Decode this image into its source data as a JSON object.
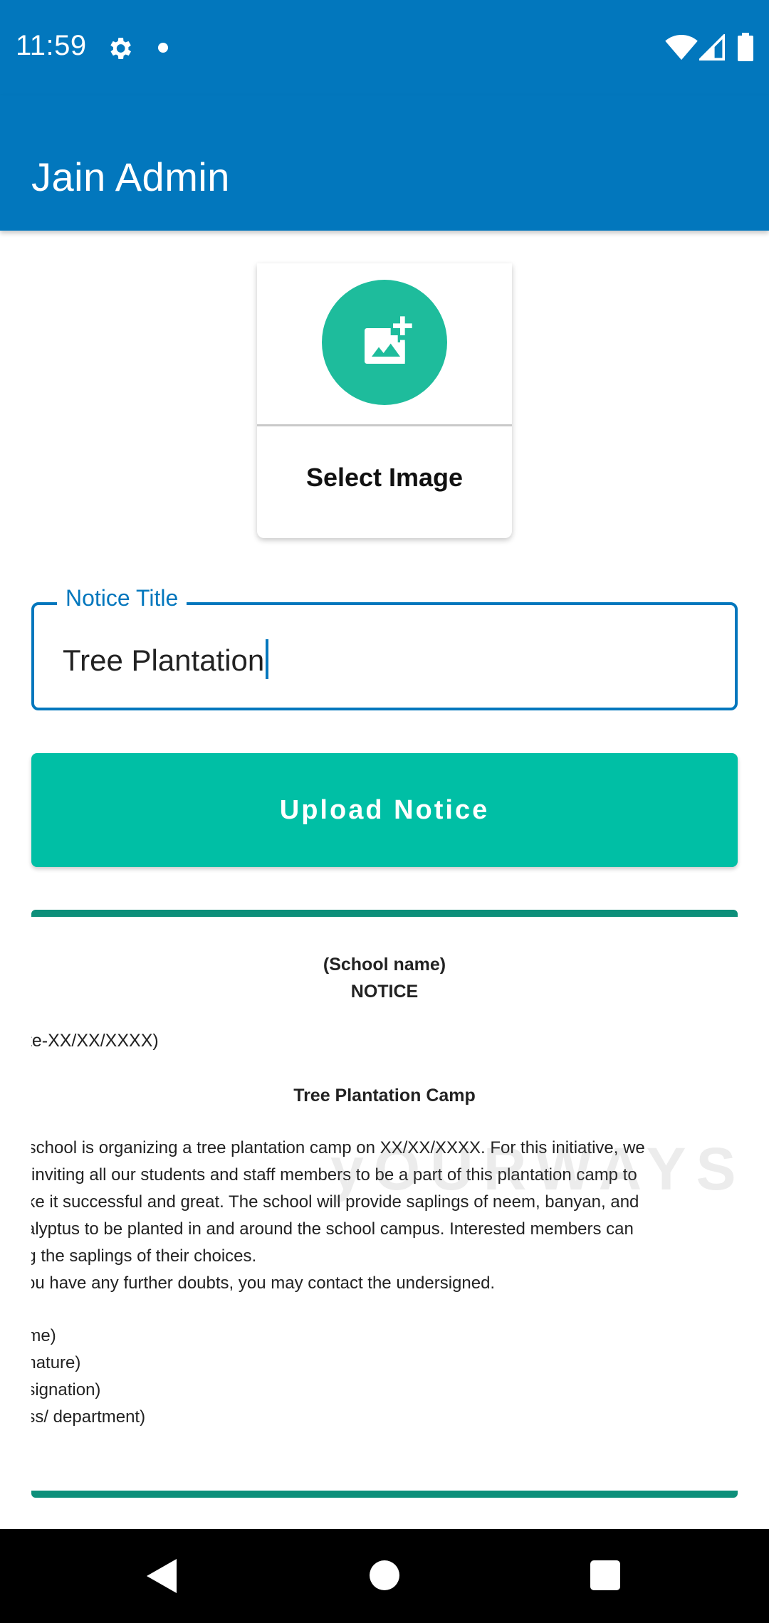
{
  "status_bar": {
    "time": "11:59",
    "icons": [
      "gear-icon",
      "notification-dot-icon",
      "wifi-icon",
      "signal-icon",
      "battery-icon"
    ]
  },
  "app_bar": {
    "title": "Jain Admin",
    "color": "#0277bd"
  },
  "image_picker": {
    "label": "Select Image",
    "icon": "add-photo-icon",
    "accent": "#1ebc9c"
  },
  "notice_title_field": {
    "label": "Notice Title",
    "value": "Tree Plantation"
  },
  "upload_button": {
    "label": "Upload Notice",
    "color": "#00bfa5"
  },
  "notice_preview": {
    "school": "(School name)",
    "heading": "NOTICE",
    "date": "ate-XX/XX/XXXX)",
    "title": "Tree Plantation Camp",
    "body_lines": [
      "r school is organizing a tree plantation camp on XX/XX/XXXX. For this initiative, we",
      "e inviting all our students and staff members to be a part of this plantation camp to",
      "ake it successful and great. The school will provide saplings of neem, banyan, and",
      "calyptus to be planted in and around the school campus. Interested members can",
      "ng the saplings of their choices.",
      "you have any further doubts, you may contact the undersigned."
    ],
    "sign_lines": [
      "ame)",
      "gnature)",
      "esignation)",
      "ass/ department)"
    ],
    "watermark": "yOURWAYS"
  },
  "nav_bar": {
    "icons": [
      "back-icon",
      "home-icon",
      "recents-icon"
    ]
  }
}
